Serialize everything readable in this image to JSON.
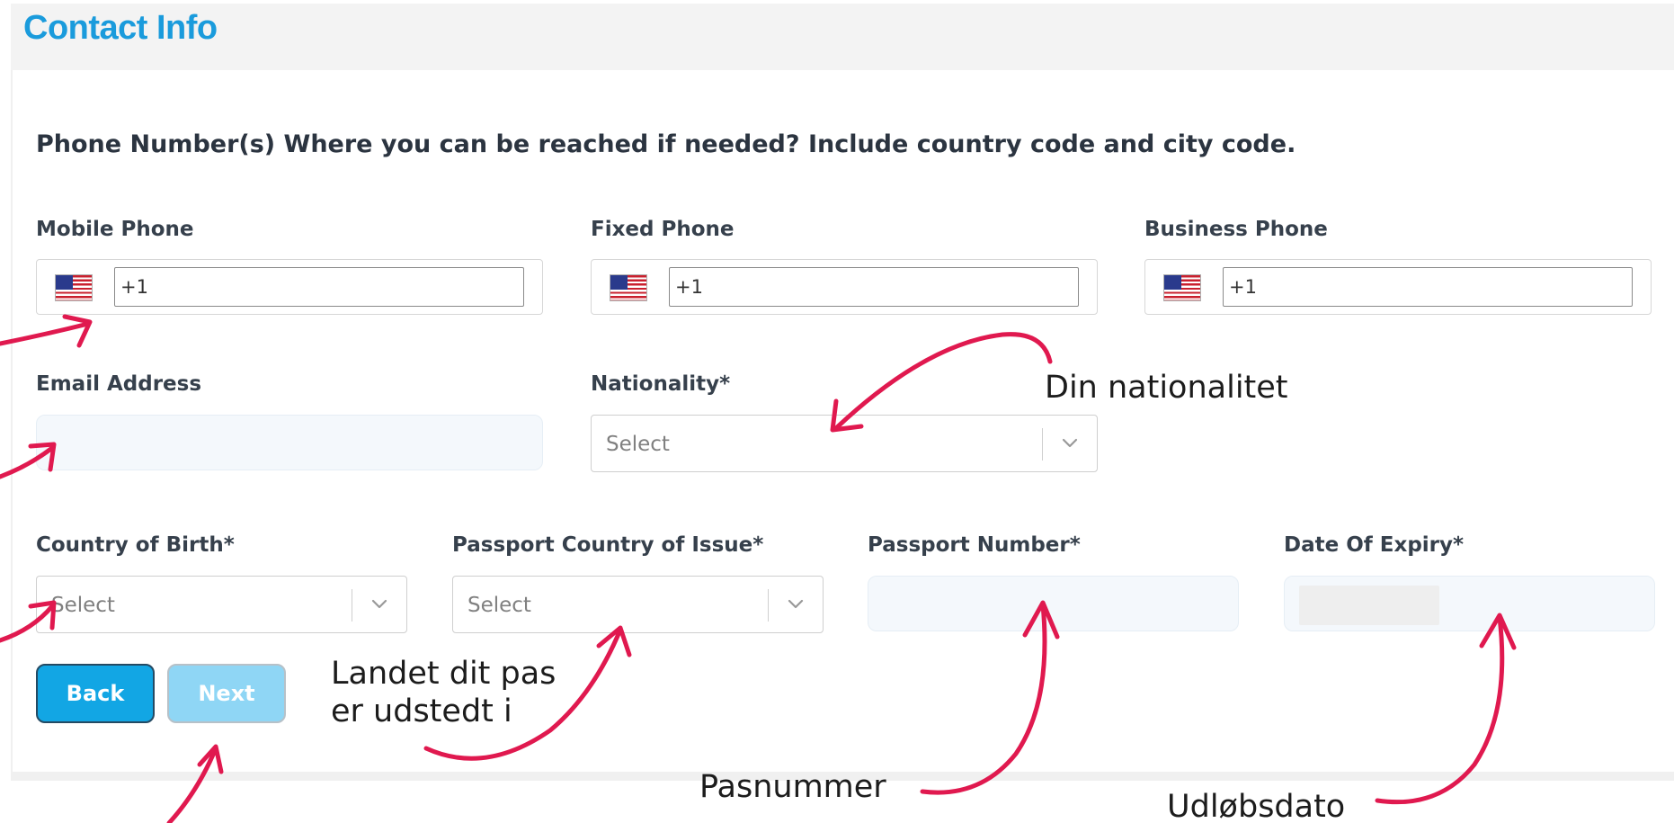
{
  "header": {
    "title": "Contact Info"
  },
  "form": {
    "question": "Phone Number(s) Where you can be reached if needed? Include country code and city code.",
    "mobile_phone": {
      "label": "Mobile Phone",
      "value": "+1",
      "flag": "us-flag-icon"
    },
    "fixed_phone": {
      "label": "Fixed Phone",
      "value": "+1",
      "flag": "us-flag-icon"
    },
    "business_phone": {
      "label": "Business Phone",
      "value": "+1",
      "flag": "us-flag-icon"
    },
    "email": {
      "label": "Email Address",
      "value": ""
    },
    "nationality": {
      "label": "Nationality*",
      "placeholder": "Select"
    },
    "country_of_birth": {
      "label": "Country of Birth*",
      "placeholder": "Select"
    },
    "passport_country": {
      "label": "Passport Country of Issue*",
      "placeholder": "Select"
    },
    "passport_number": {
      "label": "Passport Number*",
      "value": ""
    },
    "date_of_expiry": {
      "label": "Date Of Expiry*",
      "value": ""
    }
  },
  "buttons": {
    "back": "Back",
    "next": "Next"
  },
  "annotations": {
    "nationality_note": "Din nationalitet",
    "passport_country_note_line1": "Landet dit pas",
    "passport_country_note_line2": "er udstedt i",
    "passport_number_note": "Pasnummer",
    "expiry_note": "Udløbsdato"
  },
  "colors": {
    "title": "#1a9bdc",
    "back_button": "#12a6e4",
    "next_button": "#8fd6f5",
    "annotation_arrow": "#e0194f"
  }
}
